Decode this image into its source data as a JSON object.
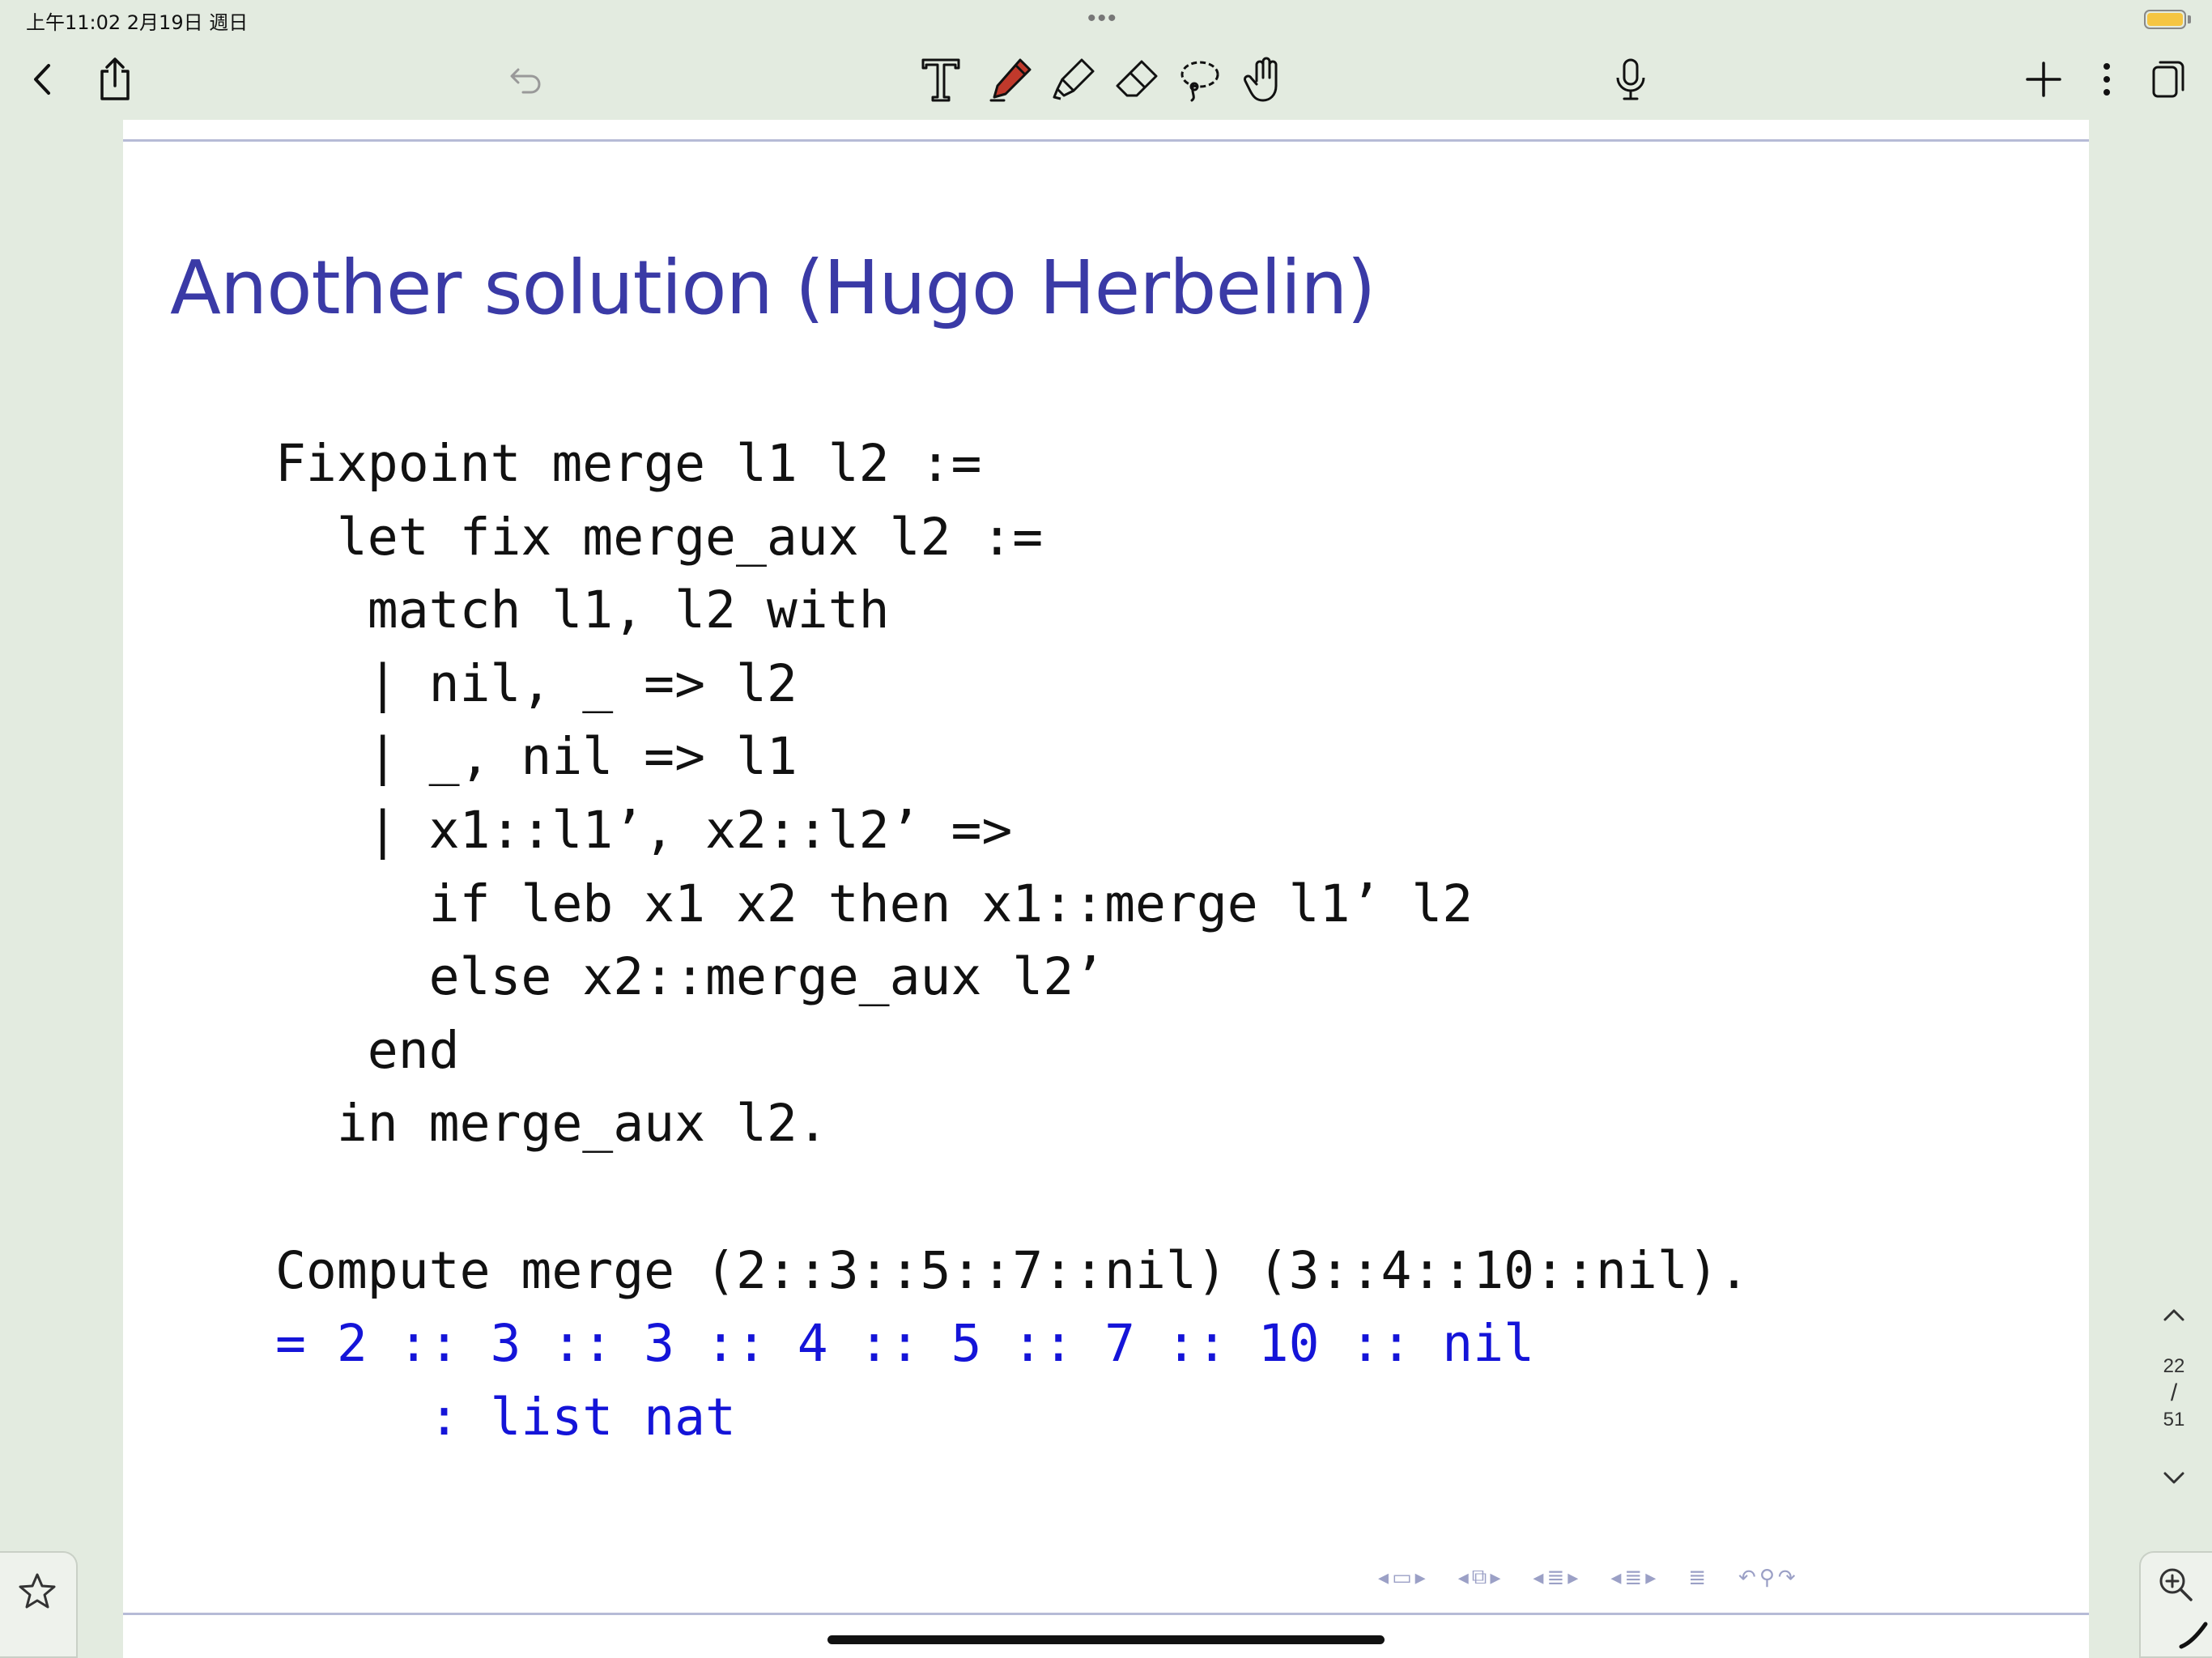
{
  "status_bar": {
    "time": "上午11:02   2月19日 週日",
    "dots": "•••",
    "battery_color": "#f5c542"
  },
  "toolbar": {
    "icons": [
      "back-chevron-icon",
      "share-icon",
      "undo-icon",
      "text-tool-icon",
      "pen-icon",
      "highlighter-icon",
      "eraser-icon",
      "lasso-icon",
      "hand-icon",
      "microphone-icon",
      "plus-icon",
      "more-vertical-icon",
      "pages-icon"
    ],
    "pen_color": "#c0392b"
  },
  "slide": {
    "title": "Another solution (Hugo Herbelin)",
    "title_color": "#3a3aa6",
    "code_lines": [
      "Fixpoint merge l1 l2 :=",
      "  let fix merge_aux l2 :=",
      "   match l1, l2 with",
      "   | nil, _ => l2",
      "   | _, nil => l1",
      "   | x1::l1’, x2::l2’ =>",
      "     if leb x1 x2 then x1::merge l1’ l2",
      "     else x2::merge_aux l2’",
      "   end",
      "  in merge_aux l2.",
      "",
      "Compute merge (2::3::5::7::nil) (3::4::10::nil)."
    ],
    "result_lines": [
      "= 2 :: 3 :: 3 :: 4 :: 5 :: 7 :: 10 :: nil",
      "     : list nat"
    ],
    "result_color": "#1414d8"
  },
  "pager": {
    "current": "22",
    "separator": "/",
    "total": "51"
  }
}
